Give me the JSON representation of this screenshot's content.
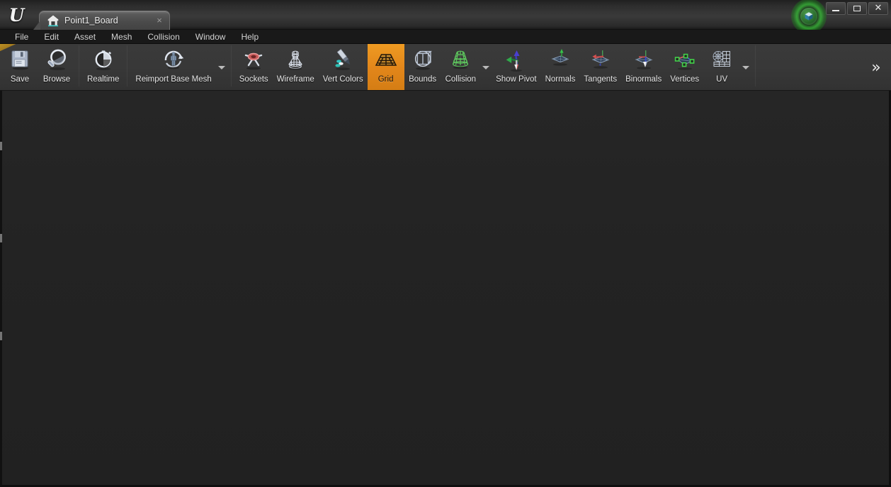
{
  "window": {
    "app": "Unreal Engine",
    "logo_glyph": "U",
    "minimize_label": "Minimize",
    "maximize_label": "Maximize",
    "close_label": "Close",
    "close_glyph": "✕"
  },
  "tab": {
    "title": "Point1_Board",
    "close_glyph": "×",
    "icon": "static-mesh-icon"
  },
  "menubar": {
    "items": [
      {
        "label": "File"
      },
      {
        "label": "Edit"
      },
      {
        "label": "Asset"
      },
      {
        "label": "Mesh"
      },
      {
        "label": "Collision"
      },
      {
        "label": "Window"
      },
      {
        "label": "Help"
      }
    ]
  },
  "toolbar": {
    "overflow_glyph": "»",
    "active_color": "#e2861a",
    "groups": [
      {
        "name": "asset",
        "buttons": [
          {
            "label": "Save",
            "icon": "floppy-disk-icon",
            "active": false,
            "dropdown": false
          },
          {
            "label": "Browse",
            "icon": "magnifier-icon",
            "active": false,
            "dropdown": false
          }
        ]
      },
      {
        "name": "realtime",
        "buttons": [
          {
            "label": "Realtime",
            "icon": "stopwatch-icon",
            "active": false,
            "dropdown": false
          }
        ]
      },
      {
        "name": "reimport",
        "buttons": [
          {
            "label": "Reimport Base Mesh",
            "icon": "reimport-mesh-icon",
            "active": false,
            "dropdown": true
          }
        ]
      },
      {
        "name": "mesh-display",
        "buttons": [
          {
            "label": "Sockets",
            "icon": "sockets-icon",
            "active": false,
            "dropdown": false
          },
          {
            "label": "Wireframe",
            "icon": "wireframe-icon",
            "active": false,
            "dropdown": false
          },
          {
            "label": "Vert Colors",
            "icon": "vert-colors-icon",
            "active": false,
            "dropdown": false
          },
          {
            "label": "Grid",
            "icon": "grid-icon",
            "active": true,
            "dropdown": false
          },
          {
            "label": "Bounds",
            "icon": "bounds-icon",
            "active": false,
            "dropdown": false
          },
          {
            "label": "Collision",
            "icon": "collision-icon",
            "active": false,
            "dropdown": true
          },
          {
            "label": "Show Pivot",
            "icon": "pivot-axes-icon",
            "active": false,
            "dropdown": false
          },
          {
            "label": "Normals",
            "icon": "normals-icon",
            "active": false,
            "dropdown": false
          },
          {
            "label": "Tangents",
            "icon": "tangents-icon",
            "active": false,
            "dropdown": false
          },
          {
            "label": "Binormals",
            "icon": "binormals-icon",
            "active": false,
            "dropdown": false
          },
          {
            "label": "Vertices",
            "icon": "vertices-icon",
            "active": false,
            "dropdown": false
          },
          {
            "label": "UV",
            "icon": "uv-icon",
            "active": false,
            "dropdown": true
          }
        ]
      }
    ]
  },
  "viewport": {
    "background": "#232323"
  }
}
